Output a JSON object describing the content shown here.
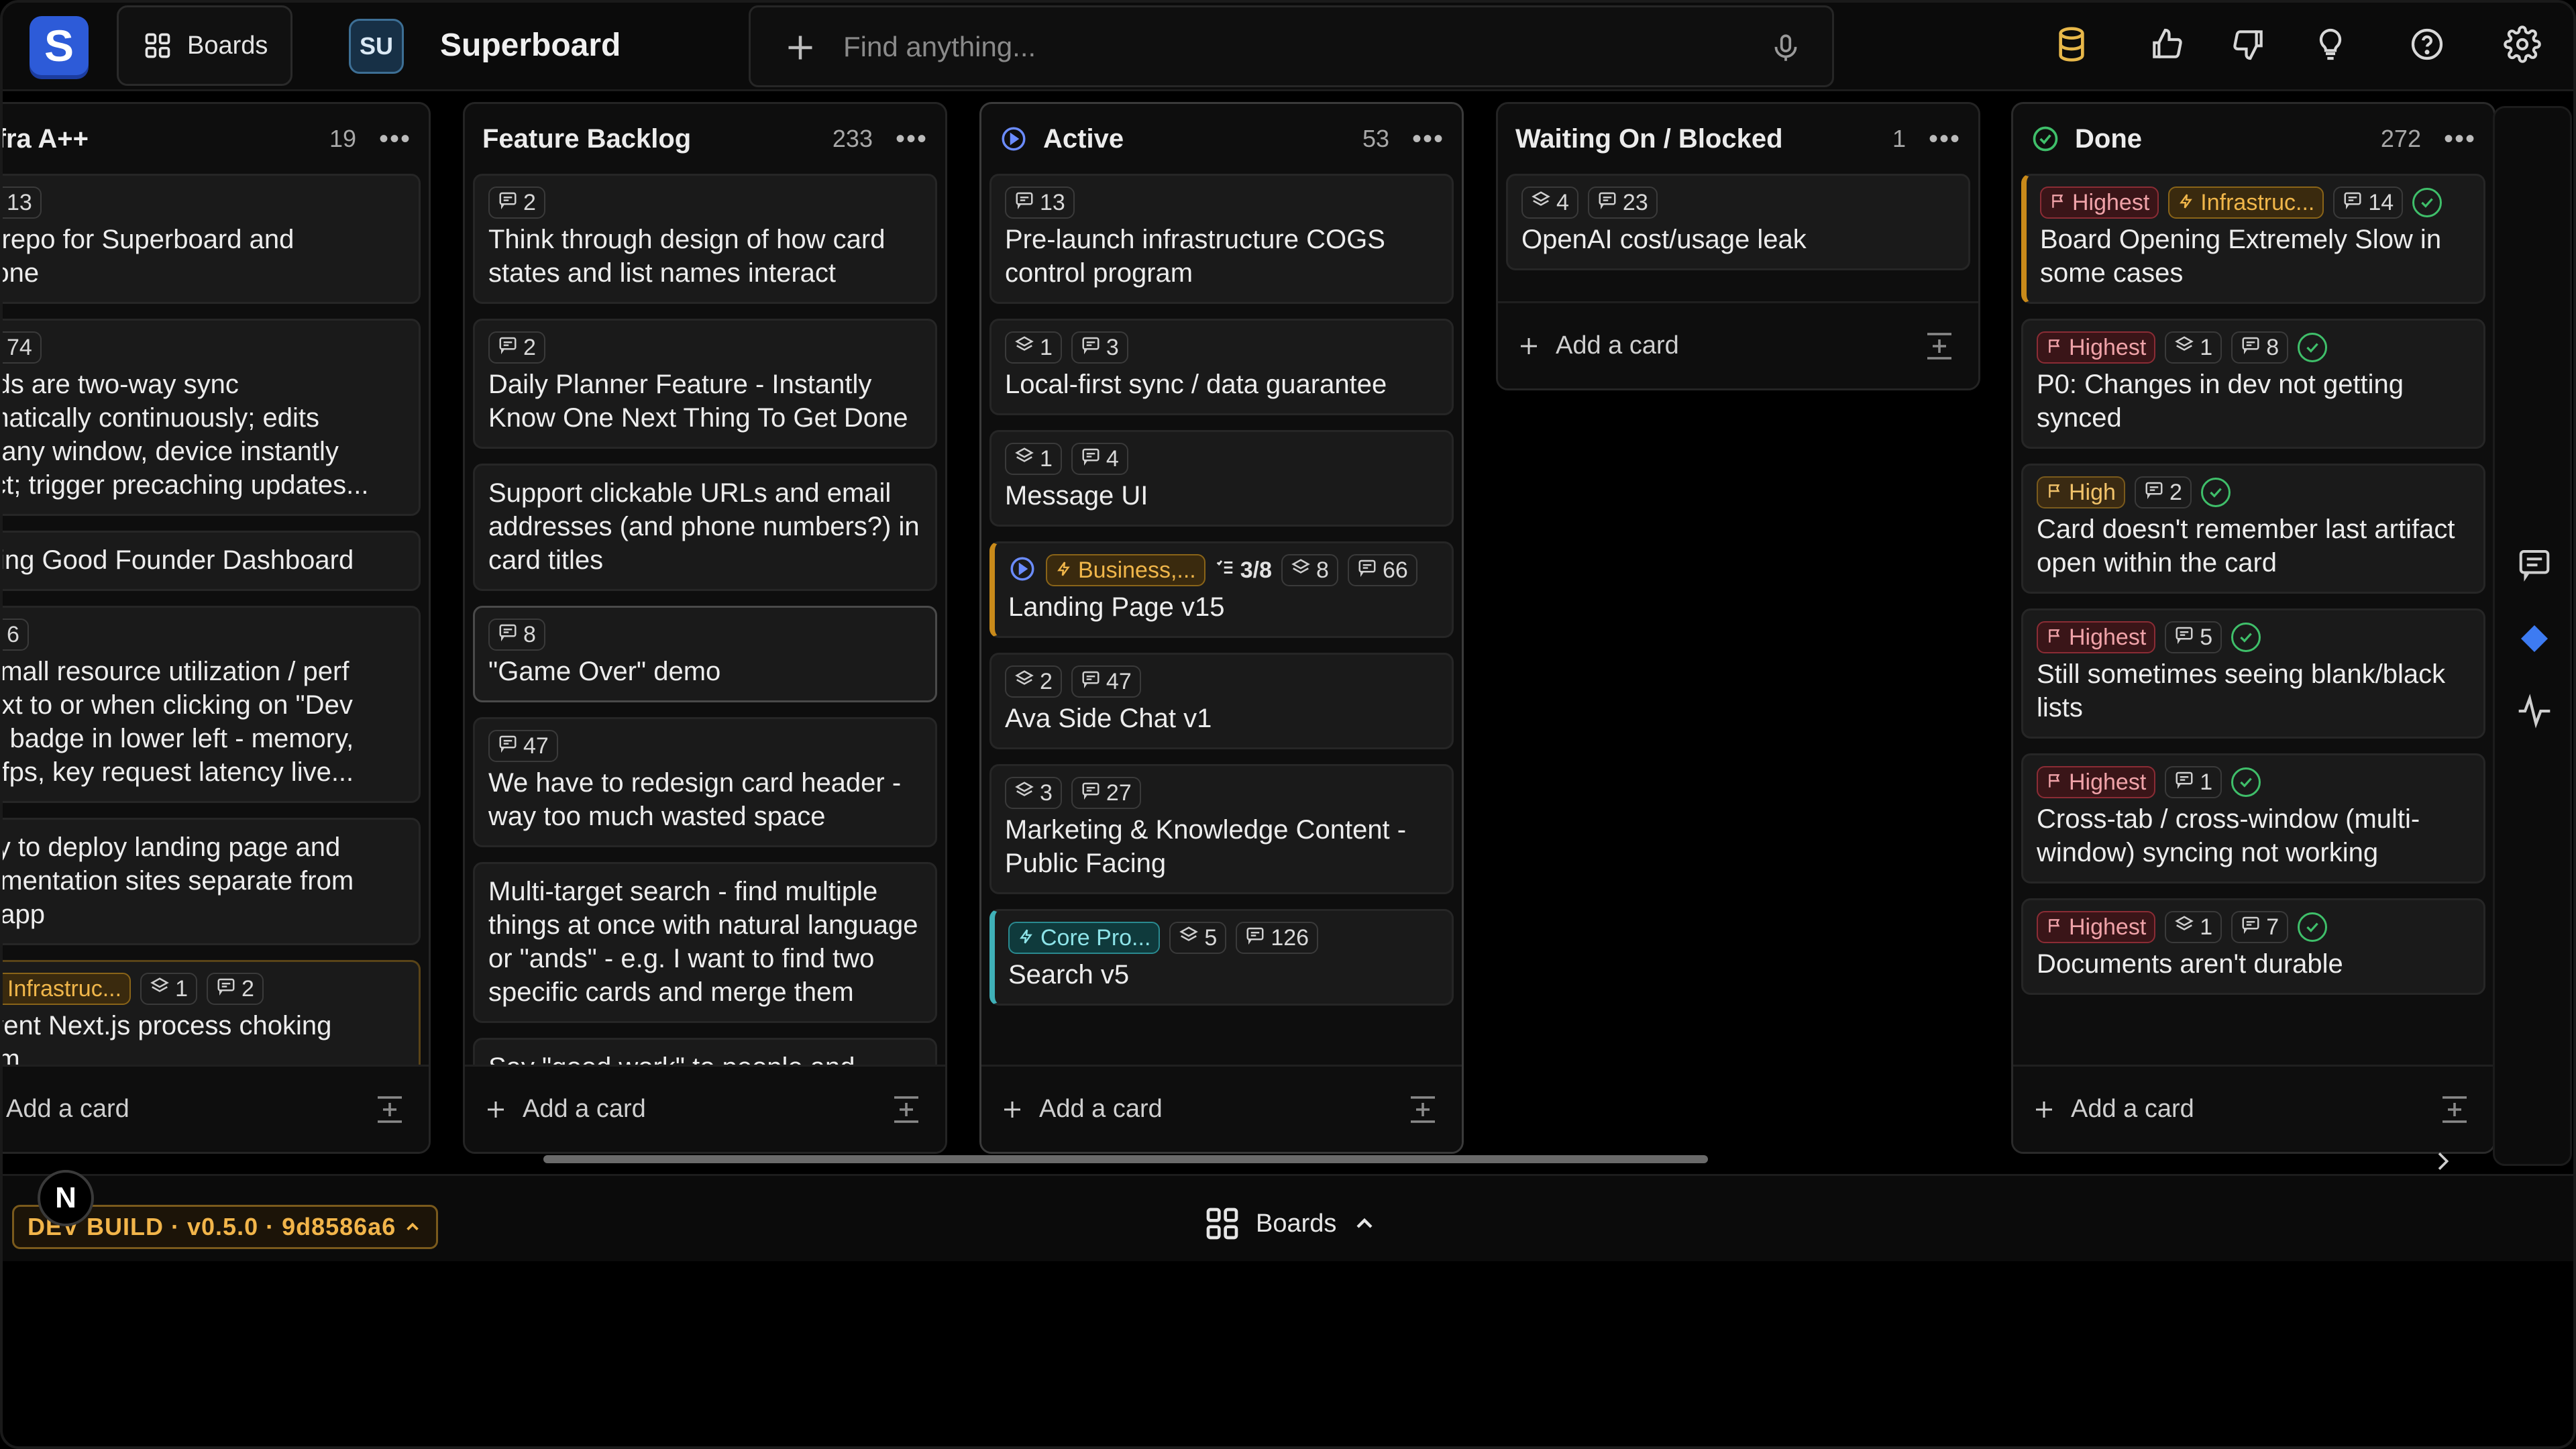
{
  "app": {
    "logo_letter": "S",
    "boards_label": "Boards",
    "workspace_avatar": "SU",
    "board_title": "Superboard"
  },
  "search": {
    "placeholder": "Find anything..."
  },
  "columns": [
    {
      "title": "/Infra A++",
      "count": "19",
      "cards": [
        {
          "badges": [
            {
              "type": "comments",
              "text": "13"
            }
          ],
          "title": "norepo for Superboard and\nu.one"
        },
        {
          "badges": [
            {
              "type": "comments",
              "text": "74"
            }
          ],
          "title": "ards are two-way sync\nomatically continuously; edits\nm any window, device instantly\nlect; trigger precaching updates..."
        },
        {
          "badges": [],
          "title": "cking Good Founder Dashboard"
        },
        {
          "badges": [
            {
              "type": "comments",
              "text": "6"
            }
          ],
          "title": "t small resource utilization / perf\nnext to or when clicking on \"Dev\nld\" badge in lower left - memory,\nu, fps, key request latency live..."
        },
        {
          "badges": [],
          "title": "ility to deploy landing page and\ncumentation sites separate from\nin app"
        },
        {
          "badges": [
            {
              "type": "infra",
              "text": "Infrastruc..."
            },
            {
              "type": "subtasks",
              "text": "1"
            },
            {
              "type": "comments",
              "text": "2"
            }
          ],
          "title": "event Next.js process choking\ntem"
        }
      ],
      "add_label": "Add a card"
    },
    {
      "title": "Feature Backlog",
      "count": "233",
      "cards": [
        {
          "badges": [
            {
              "type": "comments",
              "text": "2"
            }
          ],
          "title": "Think through design of how card\nstates and list names interact"
        },
        {
          "badges": [
            {
              "type": "comments",
              "text": "2"
            }
          ],
          "title": "Daily Planner Feature - Instantly\nKnow One Next Thing To Get Done"
        },
        {
          "badges": [],
          "title": "Support clickable URLs and email\naddresses (and phone numbers?) in\ncard titles"
        },
        {
          "badges": [
            {
              "type": "comments",
              "text": "8"
            }
          ],
          "title": "\"Game Over\" demo"
        },
        {
          "badges": [
            {
              "type": "comments",
              "text": "47"
            }
          ],
          "title": "We have to redesign card header -\nway too much wasted space"
        },
        {
          "badges": [],
          "title": "Multi-target search - find multiple\nthings at once with natural language\nor \"ands\" - e.g. I want to find two\nspecific cards and merge them"
        },
        {
          "badges": [],
          "title": "Say \"good work\" to people and"
        }
      ],
      "add_label": "Add a card"
    },
    {
      "title": "Active",
      "count": "53",
      "cards": [
        {
          "badges": [
            {
              "type": "comments",
              "text": "13"
            }
          ],
          "title": "Pre-launch infrastructure COGS\ncontrol program"
        },
        {
          "badges": [
            {
              "type": "subtasks",
              "text": "1"
            },
            {
              "type": "comments",
              "text": "3"
            }
          ],
          "title": "Local-first sync / data guarantee"
        },
        {
          "badges": [
            {
              "type": "subtasks",
              "text": "1"
            },
            {
              "type": "comments",
              "text": "4"
            }
          ],
          "title": "Message UI"
        },
        {
          "badges": [
            {
              "type": "active-icon",
              "text": ""
            },
            {
              "type": "business",
              "text": "Business,..."
            },
            {
              "type": "progress",
              "text": "3/8"
            },
            {
              "type": "subtasks",
              "text": "8"
            },
            {
              "type": "comments",
              "text": "66"
            }
          ],
          "title": "Landing Page v15"
        },
        {
          "badges": [
            {
              "type": "subtasks",
              "text": "2"
            },
            {
              "type": "comments",
              "text": "47"
            }
          ],
          "title": "Ava Side Chat v1"
        },
        {
          "badges": [
            {
              "type": "subtasks",
              "text": "3"
            },
            {
              "type": "comments",
              "text": "27"
            }
          ],
          "title": "Marketing & Knowledge Content -\nPublic Facing"
        },
        {
          "badges": [
            {
              "type": "corepro",
              "text": "Core Pro..."
            },
            {
              "type": "subtasks",
              "text": "5"
            },
            {
              "type": "comments",
              "text": "126"
            }
          ],
          "title": "Search v5"
        }
      ],
      "add_label": "Add a card"
    },
    {
      "title": "Waiting On / Blocked",
      "count": "1",
      "cards": [
        {
          "badges": [
            {
              "type": "subtasks",
              "text": "4"
            },
            {
              "type": "comments",
              "text": "23"
            }
          ],
          "title": "OpenAI cost/usage leak"
        }
      ],
      "add_label": "Add a card"
    },
    {
      "title": "Done",
      "count": "272",
      "cards": [
        {
          "badges": [
            {
              "type": "highest",
              "text": "Highest"
            },
            {
              "type": "infra",
              "text": "Infrastruc..."
            },
            {
              "type": "comments",
              "text": "14"
            },
            {
              "type": "check",
              "text": ""
            }
          ],
          "title": "Board Opening Extremely Slow in\nsome cases"
        },
        {
          "badges": [
            {
              "type": "highest",
              "text": "Highest"
            },
            {
              "type": "subtasks",
              "text": "1"
            },
            {
              "type": "comments",
              "text": "8"
            },
            {
              "type": "check",
              "text": ""
            }
          ],
          "title": "P0: Changes in dev not getting\nsynced"
        },
        {
          "badges": [
            {
              "type": "high",
              "text": "High"
            },
            {
              "type": "comments",
              "text": "2"
            },
            {
              "type": "check",
              "text": ""
            }
          ],
          "title": "Card doesn't remember last artifact\nopen within the card"
        },
        {
          "badges": [
            {
              "type": "highest",
              "text": "Highest"
            },
            {
              "type": "comments",
              "text": "5"
            },
            {
              "type": "check",
              "text": ""
            }
          ],
          "title": "Still sometimes seeing blank/black\nlists"
        },
        {
          "badges": [
            {
              "type": "highest",
              "text": "Highest"
            },
            {
              "type": "comments",
              "text": "1"
            },
            {
              "type": "check",
              "text": ""
            }
          ],
          "title": "Cross-tab / cross-window (multi-\nwindow) syncing not working"
        },
        {
          "badges": [
            {
              "type": "highest",
              "text": "Highest"
            },
            {
              "type": "subtasks",
              "text": "1"
            },
            {
              "type": "comments",
              "text": "7"
            },
            {
              "type": "check",
              "text": ""
            }
          ],
          "title": "Documents aren't durable"
        }
      ],
      "add_label": "Add a card"
    }
  ],
  "bottom": {
    "user_initial": "N",
    "dev_build": "DEV BUILD · v0.5.0 · 9d8586a6",
    "boards_label": "Boards"
  },
  "colors": {
    "highest": "#f0a3a9",
    "high": "#f2c36a",
    "infra": "#f0b64a",
    "corepro": "#8de3e8",
    "done_check": "#3fbf6a",
    "active_ring": "#6b8cff"
  }
}
